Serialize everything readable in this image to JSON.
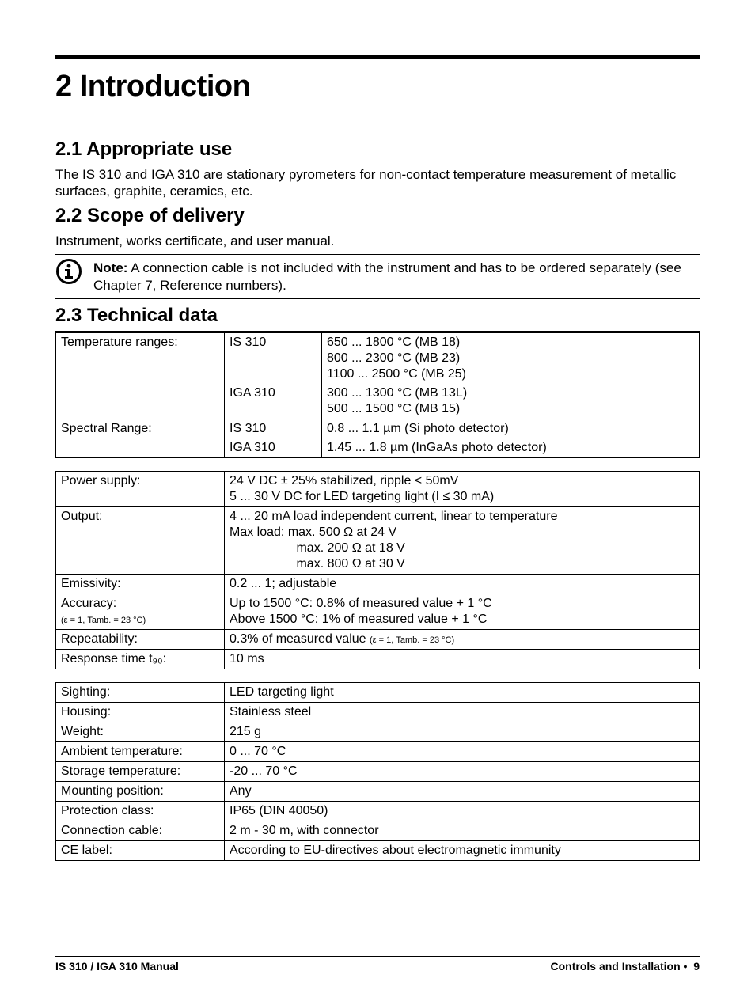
{
  "domain": "Document",
  "heading": "2  Introduction",
  "s1": {
    "title": "2.1   Appropriate use",
    "text": "The IS 310 and IGA 310 are stationary pyrometers for non-contact temperature measurement of metallic surfaces, graphite, ceramics, etc."
  },
  "s2": {
    "title": "2.2   Scope of delivery",
    "text": "Instrument, works certificate, and user manual.",
    "note_label": "Note:",
    "note_text": " A connection cable is not included with the instrument and has to be ordered separately (see Chapter 7, Reference numbers)."
  },
  "s3": {
    "title": "2.3   Technical data"
  },
  "t1": {
    "r1_label": "Temperature ranges:",
    "r1_sub": "IS 310",
    "r1_l1": "650 ... 1800 °C    (MB 18)",
    "r1_l2": "800 ... 2300 °C    (MB 23)",
    "r1_l3": "1100 ... 2500 °C  (MB 25)",
    "r2_sub": "IGA 310",
    "r2_l1": "300 ... 1300 °C    (MB 13L)",
    "r2_l2": "500 ... 1500 °C    (MB 15)",
    "r3_label": "Spectral Range:",
    "r3_sub": "IS 310",
    "r3_val": "0.8 ... 1.1 µm (Si photo detector)",
    "r4_sub": "IGA 310",
    "r4_val": "1.45 ... 1.8 µm (InGaAs photo detector)"
  },
  "t2": {
    "r1_label": "Power supply:",
    "r1_l1": "24 V DC ± 25% stabilized, ripple < 50mV",
    "r1_l2": "5 ... 30 V DC for LED targeting light (I ≤ 30 mA)",
    "r2_label": "Output:",
    "r2_l1": "4 ... 20 mA load independent current, linear to temperature",
    "r2_l2": "Max load:    max. 500 Ω at 24 V",
    "r2_l3": "                   max. 200 Ω at 18 V",
    "r2_l4": "                   max. 800 Ω at 30 V",
    "r3_label": "Emissivity:",
    "r3_val": "0.2 ... 1; adjustable",
    "r4_label": "Accuracy:",
    "r4_sub": "(ε = 1, Tamb. = 23 °C)",
    "r4_l1": "Up to 1500 °C:   0.8% of measured value + 1 °C",
    "r4_l2": "Above 1500 °C:  1% of measured value + 1 °C",
    "r5_label": "Repeatability:",
    "r5_val_a": "0.3% of measured value ",
    "r5_val_b": "(ε = 1, Tamb. = 23 °C)",
    "r6_label": "Response time t₉₀:",
    "r6_val": "10 ms"
  },
  "t3": {
    "rows": [
      [
        "Sighting:",
        "LED targeting light"
      ],
      [
        "Housing:",
        "Stainless steel"
      ],
      [
        "Weight:",
        "215 g"
      ],
      [
        "Ambient temperature:",
        "0 ... 70 °C"
      ],
      [
        "Storage temperature:",
        "-20 ... 70 °C"
      ],
      [
        "Mounting position:",
        "Any"
      ],
      [
        "Protection class:",
        "IP65 (DIN 40050)"
      ],
      [
        "Connection cable:",
        "2 m - 30 m, with connector"
      ],
      [
        "CE label:",
        "According to EU-directives about electromagnetic immunity"
      ]
    ]
  },
  "footer": {
    "left": "IS 310 / IGA 310 Manual",
    "right_text": "Controls and Installation",
    "bullet": "•",
    "page": "9"
  }
}
